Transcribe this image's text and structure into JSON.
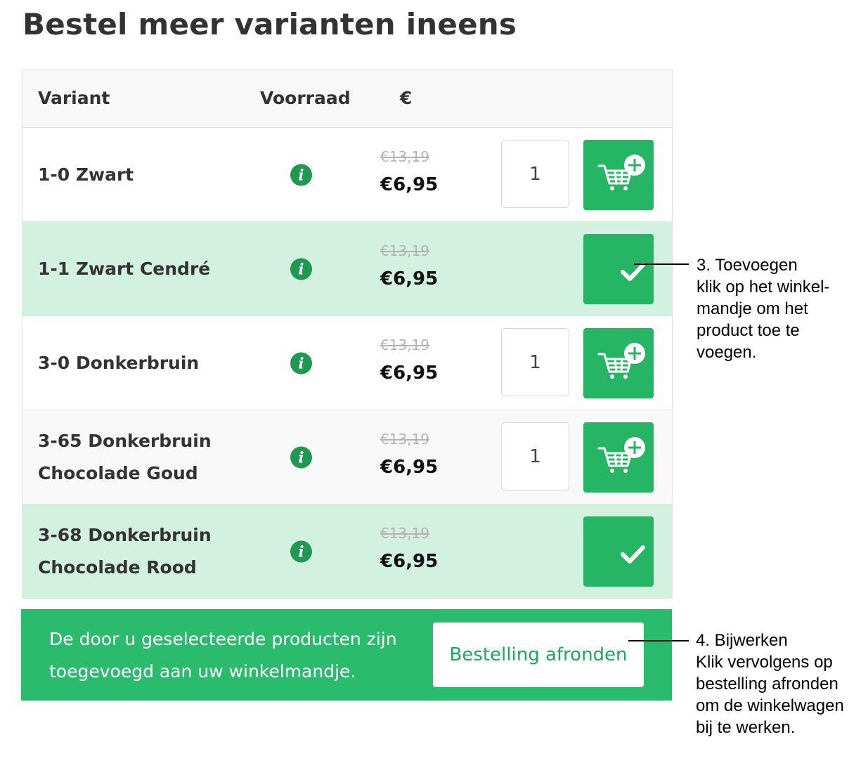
{
  "page": {
    "title": "Bestel meer varianten ineens"
  },
  "table": {
    "headers": {
      "variant": "Variant",
      "stock": "Voorraad",
      "price": "€"
    },
    "rows": [
      {
        "name": "1-0 Zwart",
        "old_price": "€13,19",
        "price": "€6,95",
        "qty": "1",
        "state": "add"
      },
      {
        "name": "1-1 Zwart Cendré",
        "old_price": "€13,19",
        "price": "€6,95",
        "qty": "",
        "state": "added"
      },
      {
        "name": "3-0 Donkerbruin",
        "old_price": "€13,19",
        "price": "€6,95",
        "qty": "1",
        "state": "add"
      },
      {
        "name": "3-65 Donkerbruin Chocolade Goud",
        "old_price": "€13,19",
        "price": "€6,95",
        "qty": "1",
        "state": "add"
      },
      {
        "name": "3-68 Donkerbruin Chocolade Rood",
        "old_price": "€13,19",
        "price": "€6,95",
        "qty": "",
        "state": "added"
      }
    ],
    "info_icon": "info-icon",
    "add_icon": "cart-plus-icon",
    "added_icon": "checkmark-icon"
  },
  "banner": {
    "message": "De door u geselecteerde producten zijn toegevoegd aan uw winkelmandje.",
    "button_label": "Bestelling afronden"
  },
  "annotations": {
    "step3": [
      "3. Toevoegen",
      "klik op het winkel-",
      "mandje om het",
      "product toe te",
      "voegen."
    ],
    "step4": [
      "4. Bijwerken",
      "Klik vervolgens op",
      "bestelling afronden",
      "om de winkelwagen",
      "bij te werken."
    ]
  },
  "colors": {
    "green": "#26b564",
    "banner_green": "#2bbb6d",
    "icon_green": "#1f9952",
    "added_row": "#d2f1e0"
  }
}
